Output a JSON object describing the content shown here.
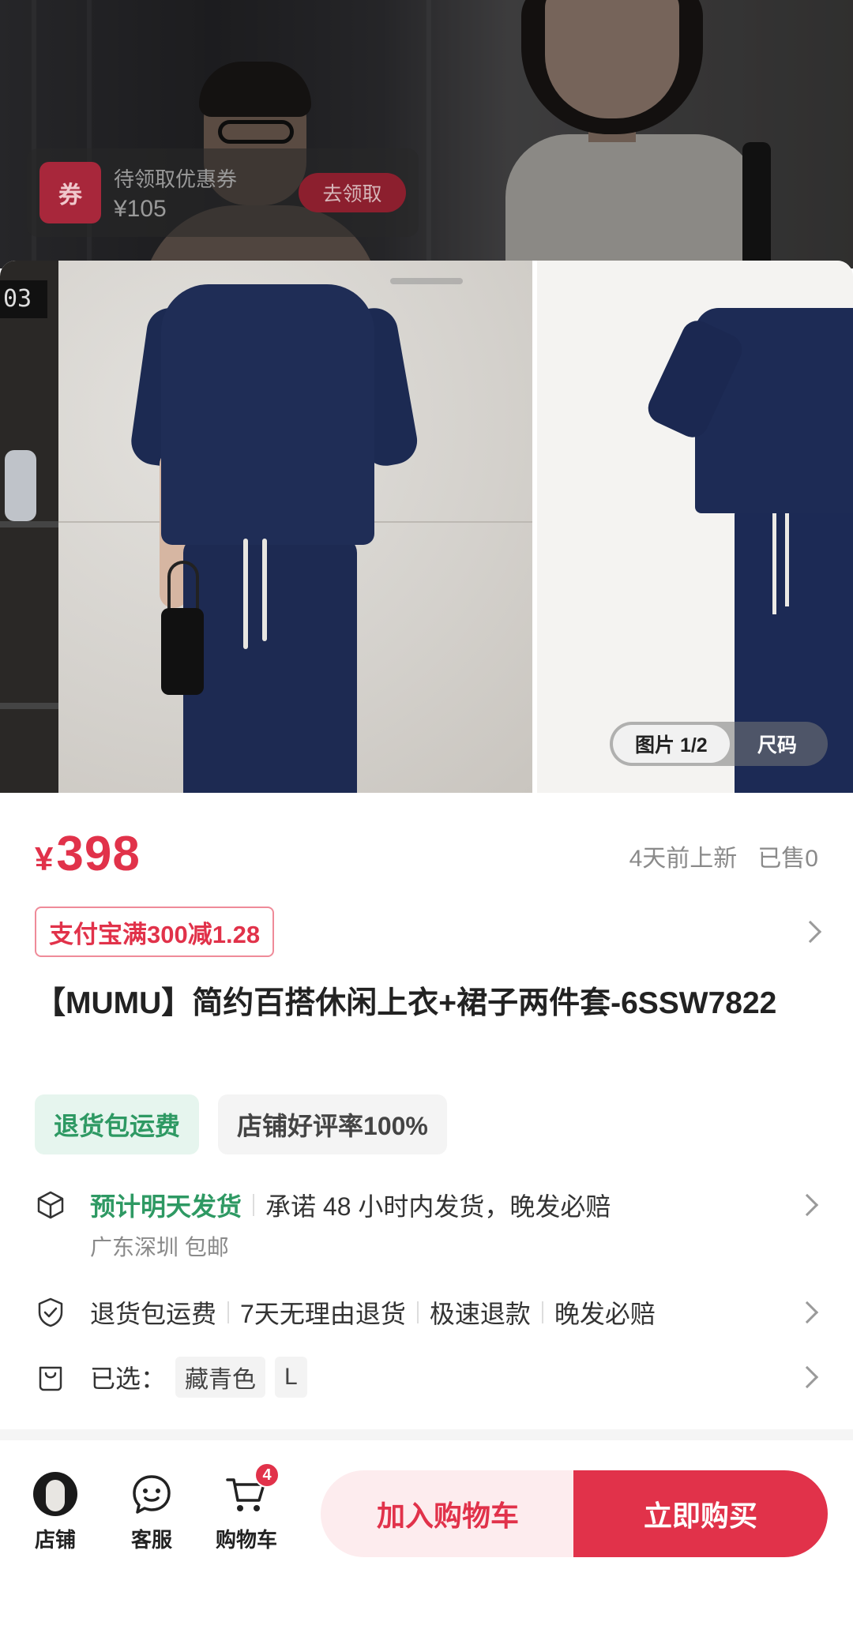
{
  "live": {
    "coupon": {
      "icon_text": "券",
      "title": "待领取优惠券",
      "amount": "¥105",
      "button": "去领取"
    }
  },
  "gallery": {
    "tab_active": "图片 1/2",
    "tab_other": "尺码",
    "shelf_clock": "03"
  },
  "product": {
    "currency": "¥",
    "price": "398",
    "listed": "4天前上新",
    "sold": "已售0",
    "promo": "支付宝满300减1.28",
    "title": "【MUMU】简约百搭休闲上衣+裙子两件套-6SSW7822",
    "badges": {
      "return_shipping": "退货包运费",
      "rating": "店铺好评率100%"
    }
  },
  "services": {
    "shipping": {
      "icon": "box-icon",
      "highlight": "预计明天发货",
      "promise": "承诺 48 小时内发货，晚发必赔",
      "sub": "广东深圳 包邮"
    },
    "guarantee": {
      "icon": "shield-check-icon",
      "items": [
        "退货包运费",
        "7天无理由退货",
        "极速退款",
        "晚发必赔"
      ]
    },
    "selected": {
      "icon": "bag-icon",
      "label": "已选：",
      "color": "藏青色",
      "size": "L"
    }
  },
  "bottom_bar": {
    "shop": "店铺",
    "service": "客服",
    "cart": "购物车",
    "cart_count": "4",
    "add_to_cart": "加入购物车",
    "buy_now": "立即购买"
  },
  "colors": {
    "accent_red": "#e1324a",
    "green": "#2e9963"
  }
}
